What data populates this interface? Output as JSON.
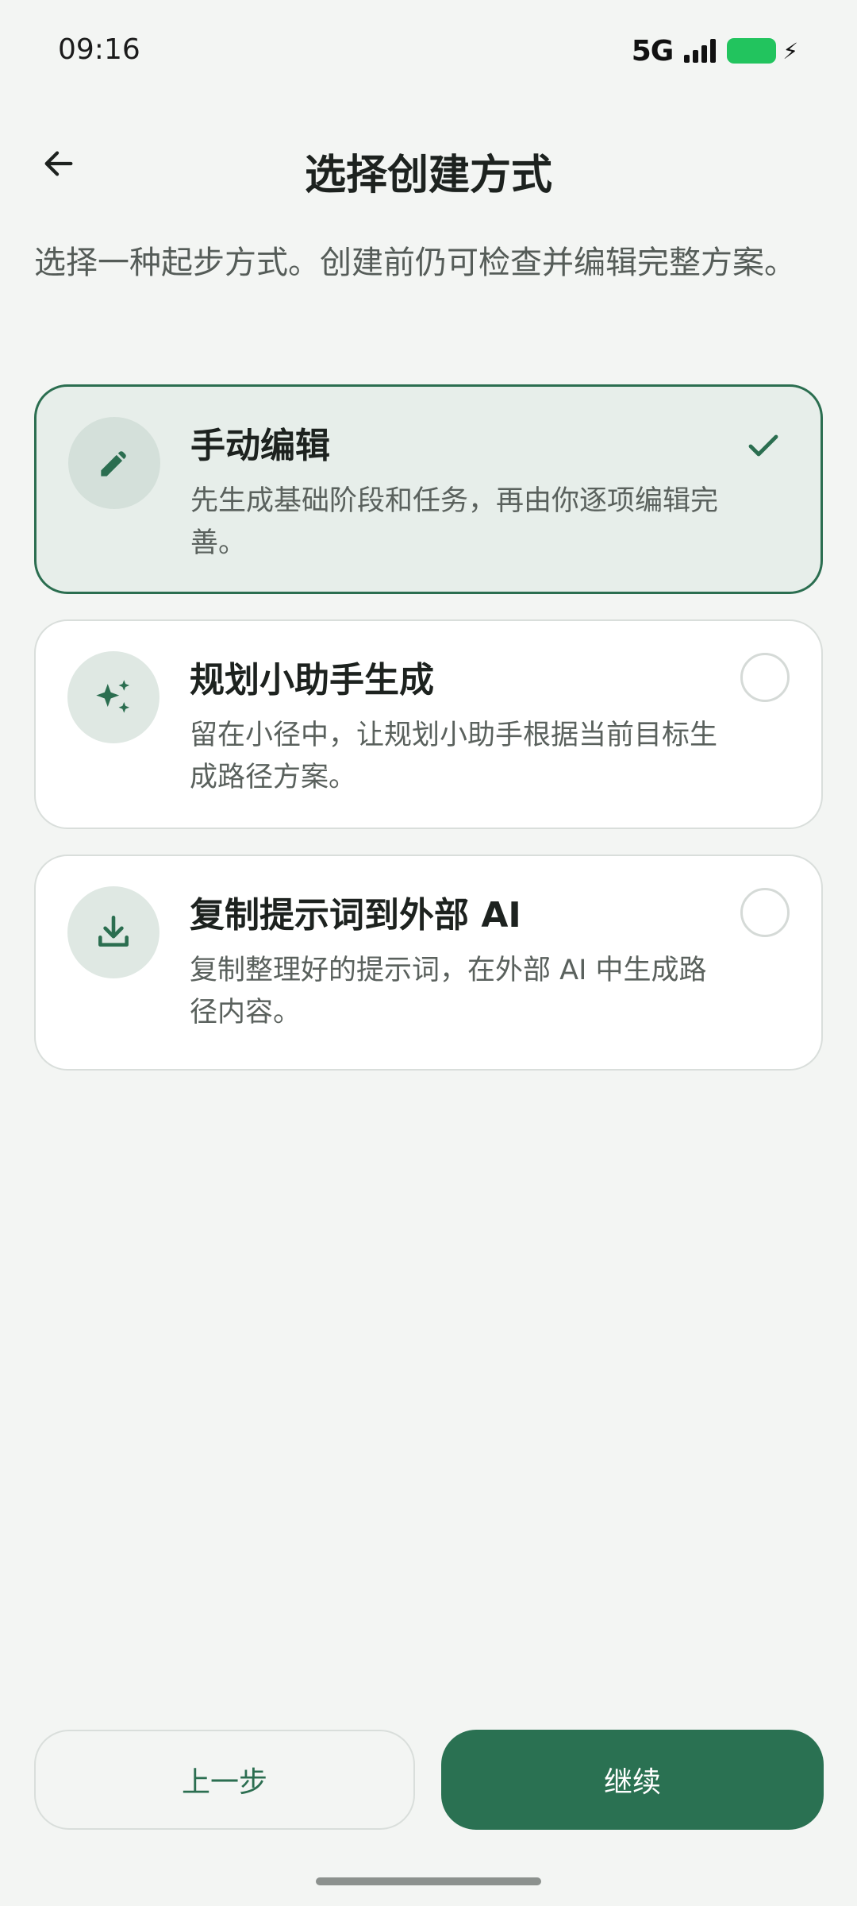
{
  "status_bar": {
    "time": "09:16",
    "network": "5G"
  },
  "header": {
    "back_icon": "arrow-left-icon",
    "title": "选择创建方式"
  },
  "intro_text": "选择一种起步方式。创建前仍可检查并编辑完整方案。",
  "options": [
    {
      "icon": "pencil-icon",
      "title": "手动编辑",
      "description": "先生成基础阶段和任务，再由你逐项编辑完善。",
      "selected": true
    },
    {
      "icon": "sparkles-icon",
      "title": "规划小助手生成",
      "description": "留在小径中，让规划小助手根据当前目标生成路径方案。",
      "selected": false
    },
    {
      "icon": "download-icon",
      "title": "复制提示词到外部 AI",
      "description": "复制整理好的提示词，在外部 AI 中生成路径内容。",
      "selected": false
    }
  ],
  "footer": {
    "prev_label": "上一步",
    "next_label": "继续"
  },
  "colors": {
    "accent": "#2a7152",
    "background": "#f3f5f3",
    "selected_card": "#e7eeea",
    "battery": "#22c45e"
  }
}
